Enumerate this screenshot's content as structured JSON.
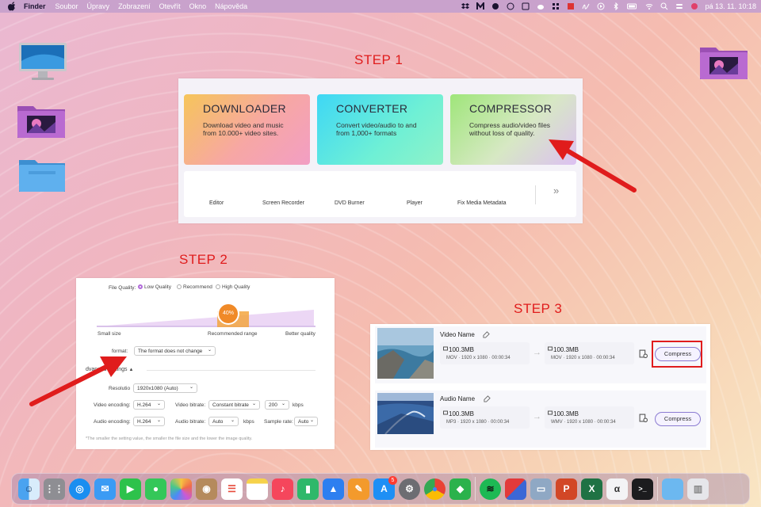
{
  "menubar": {
    "app": "Finder",
    "items": [
      "Soubor",
      "Úpravy",
      "Zobrazení",
      "Otevřít",
      "Okno",
      "Nápověda"
    ],
    "clock": "pá 13. 11. 10:18",
    "status_icons": [
      "dropbox-icon",
      "m-icon",
      "circle-icon",
      "d-icon",
      "shield-icon",
      "cloud-icon",
      "grid-icon",
      "flag-icon",
      "signature-icon",
      "play-icon",
      "bluetooth-icon",
      "battery-icon",
      "wifi-icon",
      "search-icon",
      "control-center-icon",
      "avatar-icon"
    ]
  },
  "desktop": {
    "icons": [
      "imac-icon",
      "folder-photos-icon",
      "folder-icon",
      "folder-photos-right-icon"
    ]
  },
  "steps": {
    "step1": "STEP 1",
    "step2": "STEP 2",
    "step3": "STEP 3"
  },
  "step1": {
    "cards": [
      {
        "title": "DOWNLOADER",
        "desc": "Download video and music from 10.000+ video sites."
      },
      {
        "title": "CONVERTER",
        "desc": "Convert video/audio to and from 1,000+ formats"
      },
      {
        "title": "COMPRESSOR",
        "desc": "Compress audio/video files without loss of quality."
      }
    ],
    "tools": [
      "Editor",
      "Screen Recorder",
      "DVD Burner",
      "Player",
      "Fix Media Metadata"
    ],
    "more": "»"
  },
  "step2": {
    "file_quality_label": "File Quality:",
    "quality_options": [
      "Low Quality",
      "Recommend",
      "High Quality"
    ],
    "selected_quality": "Low Quality",
    "slider_value": "40%",
    "slider_fraction": 0.4,
    "slider_labels": [
      "Small size",
      "Recommended range",
      "Better quality"
    ],
    "format_label": "Format:",
    "format_label_visible": "format:",
    "format_value": "The format does not change",
    "advanced_label": "dvanced settings",
    "resolution_label": "Resolutio",
    "resolution_value": "1920x1080 (Auto)",
    "video_encoding_label": "Video encoding:",
    "video_encoding_value": "H.264",
    "video_bitrate_label": "Video bitrate:",
    "video_bitrate_value": "Constant bitrate",
    "video_bitrate_num": "200",
    "video_bitrate_unit": "kbps",
    "audio_encoding_label": "Audio encoding:",
    "audio_encoding_value": "H.264",
    "audio_bitrate_label": "Audio bitrate:",
    "audio_bitrate_value": "Auto",
    "audio_bitrate_unit": "kbps",
    "sample_rate_label": "Sample rate:",
    "sample_rate_value": "Auto",
    "footnote": "*The smaller the setting value, the smaller the file size and the lower the image quality."
  },
  "step3": {
    "items": [
      {
        "name": "Video Name",
        "src_size": "100.3MB",
        "src_meta": "MOV · 1920 x 1080 · 00:00:34",
        "dst_size": "100.3MB",
        "dst_meta": "MOV · 1920 x 1080 · 00:00:34",
        "button": "Compress",
        "highlighted": true
      },
      {
        "name": "Audio Name",
        "src_size": "100.3MB",
        "src_meta": "MP3 · 1920 x 1080 · 00:00:34",
        "dst_size": "100.3MB",
        "dst_meta": "WMV · 1920 x 1080 · 00:00:34",
        "button": "Compress",
        "highlighted": false
      }
    ]
  },
  "dock": {
    "apps": [
      "finder-icon",
      "launchpad-icon",
      "safari-icon",
      "mail-icon",
      "facetime-icon",
      "messages-icon",
      "photos-icon",
      "contacts-icon",
      "reminders-icon",
      "notes-icon",
      "music-icon",
      "numbers-icon",
      "keynote-icon",
      "pages-icon",
      "app-store-icon",
      "system-preferences-icon",
      "chrome-icon",
      "feedly-icon",
      "spotify-icon",
      "parallels-icon",
      "migration-icon",
      "powerpoint-icon",
      "excel-icon",
      "signature-app-icon",
      "terminal-icon",
      "downloads-folder-icon",
      "trash-icon"
    ],
    "app_store_badge": "5"
  },
  "colors": {
    "accent_red": "#e01c1c",
    "step_text": "#e01c1c",
    "compress_border": "#8b7bd1"
  }
}
